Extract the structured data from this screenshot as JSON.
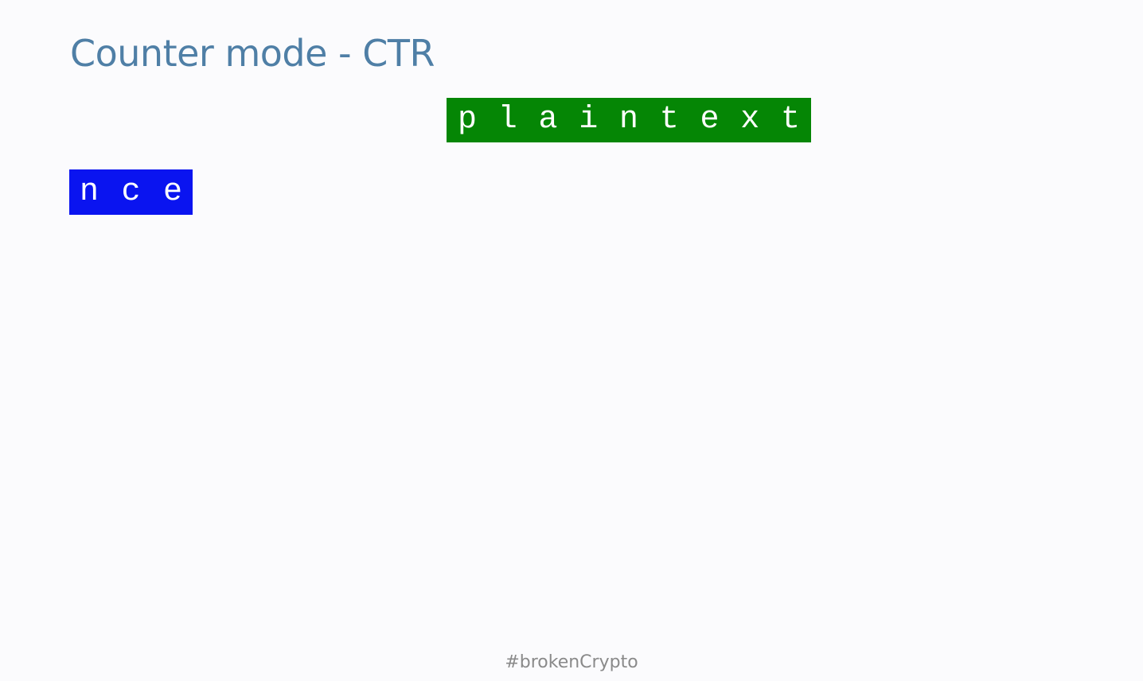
{
  "slide": {
    "title": "Counter mode - CTR",
    "footer": "#brokenCrypto"
  },
  "blocks": {
    "plaintext": {
      "chars": [
        "p",
        "l",
        "a",
        "i",
        "n",
        "t",
        "e",
        "x",
        "t"
      ],
      "color": "#058605"
    },
    "nonce": {
      "chars": [
        "n",
        "c",
        "e"
      ],
      "color": "#0a14f0"
    }
  },
  "colors": {
    "title": "#4f7fa6",
    "background": "#fbfbfd",
    "footer": "#8a8a8a"
  }
}
